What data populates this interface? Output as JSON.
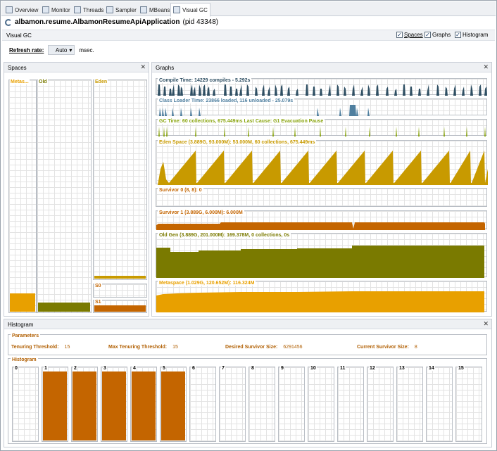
{
  "tabs": [
    {
      "label": "Overview",
      "icon": "overview-icon"
    },
    {
      "label": "Monitor",
      "icon": "monitor-icon"
    },
    {
      "label": "Threads",
      "icon": "threads-icon"
    },
    {
      "label": "Sampler",
      "icon": "sampler-icon"
    },
    {
      "label": "MBeans",
      "icon": "mbeans-icon"
    },
    {
      "label": "Visual GC",
      "icon": "visualgc-icon"
    }
  ],
  "app": {
    "name": "albamon.resume.AlbamonResumeApiApplication",
    "pid": "(pid 43348)"
  },
  "subbar": {
    "label": "Visual GC",
    "spaces": "Spaces",
    "graphs": "Graphs",
    "histogram": "Histogram"
  },
  "refresh": {
    "label": "Refresh rate:",
    "value": "Auto",
    "unit": "msec."
  },
  "spaces_panel": {
    "title": "Spaces",
    "metaspace": {
      "label": "Metas...",
      "fill": 0.08
    },
    "old": {
      "label": "Old",
      "fill": 0.04
    },
    "eden": {
      "label": "Eden",
      "fill": 0.01
    },
    "s0": {
      "label": "S0",
      "fill": 0.0
    },
    "s1": {
      "label": "S1",
      "fill": 0.55
    }
  },
  "graphs_panel": {
    "title": "Graphs",
    "compile": "Compile Time: 14229 compiles - 5.292s",
    "classloader": "Class Loader Time: 23866 loaded, 116 unloaded - 25.079s",
    "gc": "GC Time: 60 collections, 675.449ms Last Cause: G1 Evacuation Pause",
    "eden": "Eden Space (3.889G, 93.000M): 53.000M, 60 collections, 675.449ms",
    "s0": "Survivor 0 (8, 8): 0",
    "s1": "Survivor 1 (3.889G, 6.000M): 6.000M",
    "old": "Old Gen (3.889G, 201.000M): 169.378M, 0 collections, 0s",
    "meta": "Metaspace (1.029G, 120.652M): 116.324M"
  },
  "histogram_panel": {
    "title": "Histogram",
    "params_title": "Parameters",
    "params": [
      {
        "k": "Tenuring Threshold:",
        "v": "15"
      },
      {
        "k": "Max Tenuring Threshold:",
        "v": "15"
      },
      {
        "k": "Desired Survivor Size:",
        "v": "6291456"
      },
      {
        "k": "Current Survivor Size:",
        "v": "8"
      }
    ],
    "histo_title": "Histogram",
    "bins": [
      {
        "label": "0",
        "fill": 0.0
      },
      {
        "label": "1",
        "fill": 0.93
      },
      {
        "label": "2",
        "fill": 0.93
      },
      {
        "label": "3",
        "fill": 0.93
      },
      {
        "label": "4",
        "fill": 0.93
      },
      {
        "label": "5",
        "fill": 0.93
      },
      {
        "label": "6",
        "fill": 0.0
      },
      {
        "label": "7",
        "fill": 0.0
      },
      {
        "label": "8",
        "fill": 0.0
      },
      {
        "label": "9",
        "fill": 0.0
      },
      {
        "label": "10",
        "fill": 0.0
      },
      {
        "label": "11",
        "fill": 0.0
      },
      {
        "label": "12",
        "fill": 0.0
      },
      {
        "label": "13",
        "fill": 0.0
      },
      {
        "label": "14",
        "fill": 0.0
      },
      {
        "label": "15",
        "fill": 0.0
      }
    ]
  },
  "colors": {
    "compile": "#2f4f63",
    "classloader": "#4f7f9f",
    "gc": "#8aa510",
    "eden": "#c89a00",
    "survivor": "#c46500",
    "old": "#7a7a00",
    "meta": "#e8a000",
    "label_orange": "#b05e00"
  }
}
